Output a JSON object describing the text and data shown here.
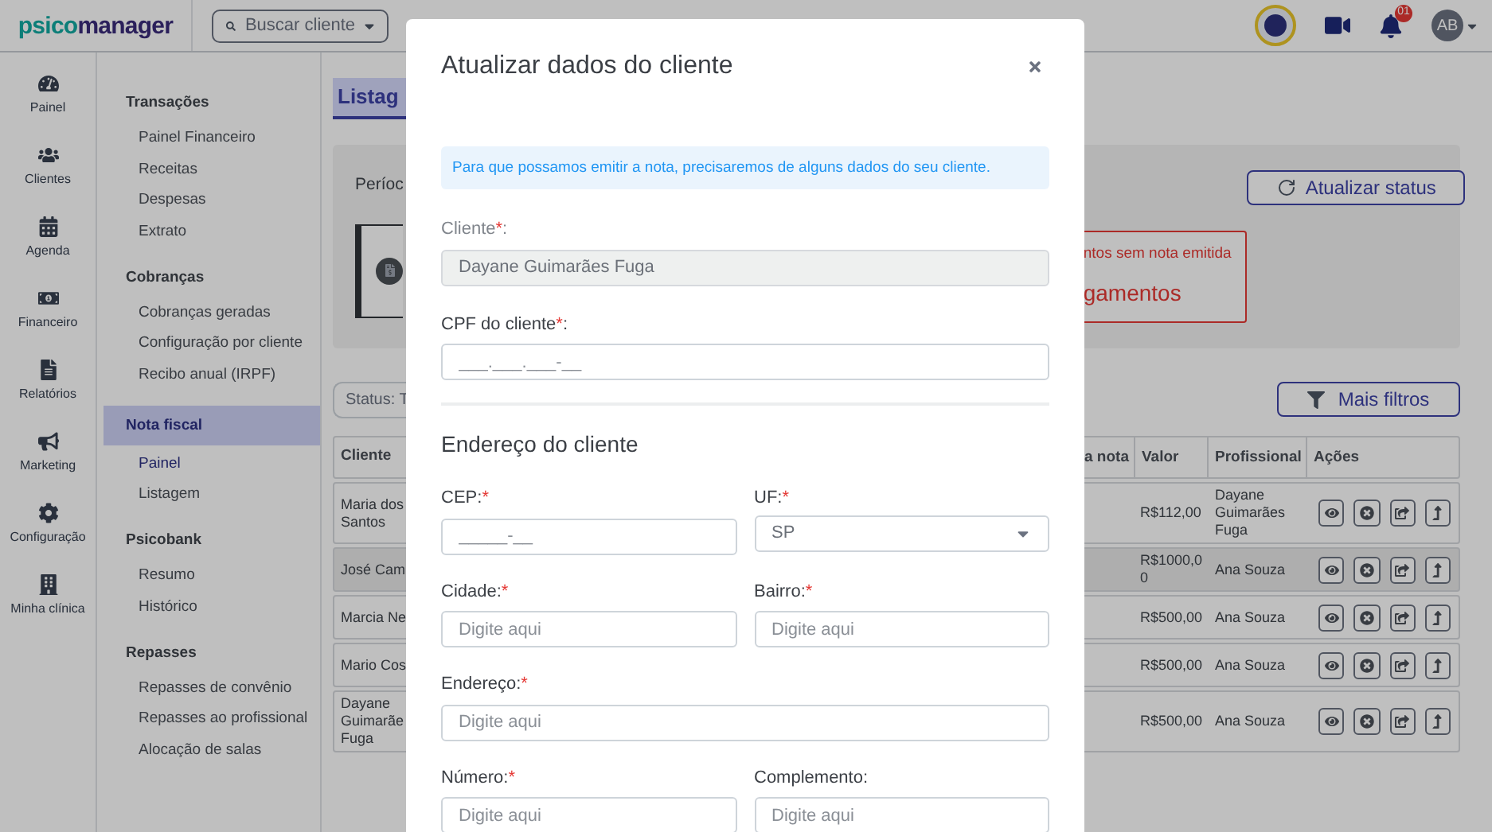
{
  "header": {
    "logo": [
      "psico",
      "manager"
    ],
    "search": {
      "placeholder": "Buscar cliente"
    },
    "notifications_badge": "01",
    "avatar": "AB"
  },
  "rail": [
    {
      "label": "Painel"
    },
    {
      "label": "Clientes"
    },
    {
      "label": "Agenda"
    },
    {
      "label": "Financeiro"
    },
    {
      "label": "Relatórios"
    },
    {
      "label": "Marketing"
    },
    {
      "label": "Configuração"
    },
    {
      "label": "Minha clínica"
    }
  ],
  "menu": [
    {
      "title": "Transações",
      "selected": false,
      "items": [
        {
          "label": "Painel Financeiro",
          "selected": false
        },
        {
          "label": "Receitas",
          "selected": false
        },
        {
          "label": "Despesas",
          "selected": false
        },
        {
          "label": "Extrato",
          "selected": false
        }
      ]
    },
    {
      "title": "Cobranças",
      "selected": false,
      "items": [
        {
          "label": "Cobranças geradas",
          "selected": false
        },
        {
          "label": "Configuração por cliente",
          "selected": false
        },
        {
          "label": "Recibo anual (IRPF)",
          "selected": false
        }
      ]
    },
    {
      "title": "Nota fiscal",
      "selected": true,
      "items": [
        {
          "label": "Painel",
          "selected": true
        },
        {
          "label": "Listagem",
          "selected": false
        }
      ]
    },
    {
      "title": "Psicobank",
      "selected": false,
      "items": [
        {
          "label": "Resumo",
          "selected": false
        },
        {
          "label": "Histórico",
          "selected": false
        }
      ]
    },
    {
      "title": "Repasses",
      "selected": false,
      "items": [
        {
          "label": "Repasses de convênio",
          "selected": false
        },
        {
          "label": "Repasses ao profissional",
          "selected": false
        },
        {
          "label": "Alocação de salas",
          "selected": false
        }
      ]
    }
  ],
  "page": {
    "tab": "Listag",
    "period_label": "Períoc",
    "refresh_button": "Atualizar status",
    "alert": {
      "line1": "ntos sem nota emitida",
      "line2": "gamentos"
    },
    "status_filter": "Status: T",
    "more_filters_button": "Mais filtros"
  },
  "table": {
    "columns": [
      "Cliente",
      "a nota",
      "Valor",
      "Profissional",
      "Ações"
    ],
    "rows": [
      {
        "client": "Maria dos Santos",
        "value": "R$112,00",
        "professional": "Dayane Guimarães Fuga",
        "selected": false
      },
      {
        "client": "José Cam",
        "value": "R$1000,00",
        "professional": "Ana Souza",
        "selected": true
      },
      {
        "client": "Marcia Ne",
        "value": "R$500,00",
        "professional": "Ana Souza",
        "selected": false
      },
      {
        "client": "Mario Cos",
        "value": "R$500,00",
        "professional": "Ana Souza",
        "selected": false
      },
      {
        "client": "Dayane Guimarãe Fuga",
        "value": "R$500,00",
        "professional": "Ana Souza",
        "selected": false
      }
    ]
  },
  "modal": {
    "title": "Atualizar dados do cliente",
    "info": "Para que possamos emitir a nota, precisaremos de alguns dados do seu cliente.",
    "client_field": {
      "label": "Cliente",
      "mark": "*",
      "suffix": ":",
      "value": "Dayane Guimarães Fuga",
      "disabled": true
    },
    "cpf_field": {
      "label": "CPF do cliente",
      "mark": "*",
      "suffix": ":",
      "placeholder": "___.___.___-__"
    },
    "address_title": "Endereço do cliente",
    "address_fields": [
      {
        "kind": "text",
        "label": "CEP:",
        "mark": "*",
        "placeholder": "_____-__",
        "wide": false
      },
      {
        "kind": "select",
        "label": "UF:",
        "mark": "*",
        "value": "SP",
        "wide": false
      },
      {
        "kind": "text",
        "label": "Cidade:",
        "mark": "*",
        "placeholder": "Digite aqui",
        "wide": false
      },
      {
        "kind": "text",
        "label": "Bairro:",
        "mark": "*",
        "placeholder": "Digite aqui",
        "wide": false
      },
      {
        "kind": "text",
        "label": "Endereço:",
        "mark": "*",
        "placeholder": "Digite aqui",
        "wide": true
      },
      {
        "kind": "text",
        "label": "Número:",
        "mark": "*",
        "placeholder": "Digite aqui",
        "wide": false
      },
      {
        "kind": "text",
        "label": "Complemento:",
        "placeholder": "Digite aqui",
        "wide": false
      }
    ]
  }
}
